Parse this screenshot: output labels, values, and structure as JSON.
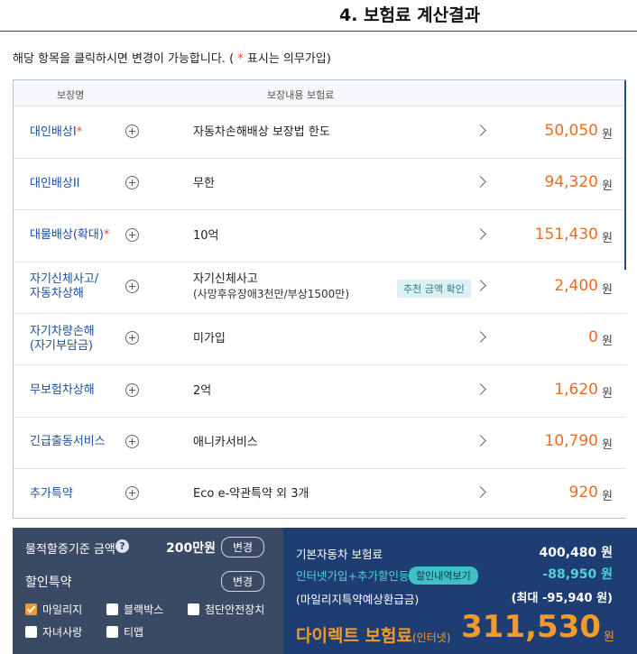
{
  "header": {
    "title": "4. 보험료 계산결과"
  },
  "notice": {
    "text_before": "해당 항목을 클릭하시면 변경이 가능합니다. ( ",
    "star": "*",
    "text_after": " 표시는 의무가입)"
  },
  "table": {
    "col_name": "보장명",
    "col_content": "보장내용  보험료",
    "rows": [
      {
        "name": "대인배상I",
        "required": "*",
        "content": "자동차손해배상 보장법 한도",
        "sub": "",
        "badge": "",
        "amount": "50,050",
        "unit": "원"
      },
      {
        "name": "대인배상II",
        "required": "",
        "content": "무한",
        "sub": "",
        "badge": "",
        "amount": "94,320",
        "unit": "원"
      },
      {
        "name": "대물배상(확대)",
        "required": "*",
        "content": "10억",
        "sub": "",
        "badge": "",
        "amount": "151,430",
        "unit": "원"
      },
      {
        "name": "자기신체사고/\n자동차상해",
        "required": "",
        "content": "자기신체사고",
        "sub": "(사망후유장애3천만/부상1500만)",
        "badge": "추천 금액 확인",
        "amount": "2,400",
        "unit": "원"
      },
      {
        "name": "자기차량손해\n(자기부담금)",
        "required": "",
        "content": "미가입",
        "sub": "",
        "badge": "",
        "amount": "0",
        "unit": "원"
      },
      {
        "name": "무보험차상해",
        "required": "",
        "content": "2억",
        "sub": "",
        "badge": "",
        "amount": "1,620",
        "unit": "원"
      },
      {
        "name": "긴급출동서비스",
        "required": "",
        "content": "애니카서비스",
        "sub": "",
        "badge": "",
        "amount": "10,790",
        "unit": "원"
      },
      {
        "name": "추가특약",
        "required": "",
        "content": "Eco e-약관특약 외 3개",
        "sub": "",
        "badge": "",
        "amount": "920",
        "unit": "원"
      }
    ]
  },
  "options": {
    "property_label": "물적할증기준 금액",
    "help_icon": "?",
    "property_value": "200만원",
    "change_label": "변경",
    "discount_label": "할인특약",
    "discount_change_label": "변경",
    "discounts": [
      {
        "label": "마일리지",
        "checked": true
      },
      {
        "label": "블랙박스",
        "checked": false
      },
      {
        "label": "첨단안전장치",
        "checked": false
      },
      {
        "label": "자녀사랑",
        "checked": false
      },
      {
        "label": "티맵",
        "checked": false
      }
    ]
  },
  "summary": {
    "base_label": "기본자동차 보험료",
    "base_value": "400,480 원",
    "online_label": "인터넷가입+추가할인등",
    "online_button": "할인내역보기",
    "online_value": "-88,950 원",
    "mileage_label": "(마일리지특약예상환급금)",
    "mileage_value": "(최대 -95,940 원)",
    "direct_label": "다이렉트 보험료",
    "direct_sub": "(인터넷)",
    "direct_value": "311,530",
    "direct_unit": "원"
  },
  "colors": {
    "accent": "#ef6b21",
    "navy": "#1e3d73",
    "link": "#1d4e9a",
    "teal": "#3fc1c3"
  }
}
